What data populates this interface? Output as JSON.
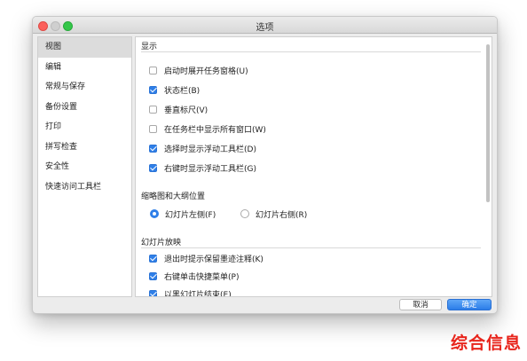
{
  "window": {
    "title": "选项"
  },
  "sidebar": {
    "items": [
      {
        "label": "视图",
        "selected": true
      },
      {
        "label": "编辑",
        "selected": false
      },
      {
        "label": "常规与保存",
        "selected": false
      },
      {
        "label": "备份设置",
        "selected": false
      },
      {
        "label": "打印",
        "selected": false
      },
      {
        "label": "拼写检查",
        "selected": false
      },
      {
        "label": "安全性",
        "selected": false
      },
      {
        "label": "快速访问工具栏",
        "selected": false
      }
    ]
  },
  "content": {
    "display": {
      "header": "显示",
      "options": [
        {
          "label": "启动时展开任务窗格(U)",
          "checked": false
        },
        {
          "label": "状态栏(B)",
          "checked": true
        },
        {
          "label": "垂直标尺(V)",
          "checked": false
        },
        {
          "label": "在任务栏中显示所有窗口(W)",
          "checked": false
        },
        {
          "label": "选择时显示浮动工具栏(D)",
          "checked": true
        },
        {
          "label": "右键时显示浮动工具栏(G)",
          "checked": true
        }
      ]
    },
    "thumbnail": {
      "header": "缩略图和大纲位置",
      "options": [
        {
          "label": "幻灯片左侧(F)",
          "checked": true
        },
        {
          "label": "幻灯片右侧(R)",
          "checked": false
        }
      ]
    },
    "slideshow": {
      "header": "幻灯片放映",
      "options": [
        {
          "label": "退出时提示保留墨迹注释(K)",
          "checked": true
        },
        {
          "label": "右键单击快捷菜单(P)",
          "checked": true
        },
        {
          "label": "以黑幻灯片结束(E)",
          "checked": true
        }
      ]
    }
  },
  "buttons": {
    "cancel": "取消",
    "ok": "确定"
  },
  "watermark": "综合信息",
  "colors": {
    "accent": "#2f7fe8",
    "watermark": "#e8251c"
  }
}
